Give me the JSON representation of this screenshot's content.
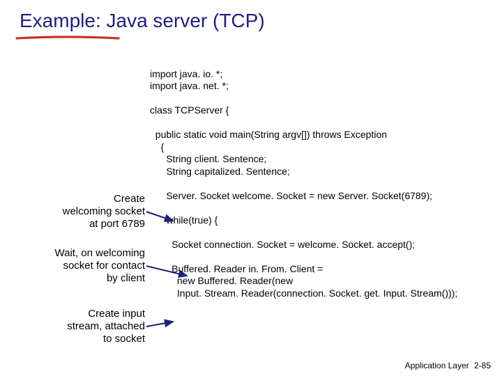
{
  "title": "Example: Java server (TCP)",
  "code": {
    "l1": "import java. io. *;",
    "l2": "import java. net. *;",
    "l3": "class TCPServer {",
    "l4": "  public static void main(String argv[]) throws Exception",
    "l5": "    {",
    "l6": "      String client. Sentence;",
    "l7": "      String capitalized. Sentence;",
    "l8": "      Server. Socket welcome. Socket = new Server. Socket(6789);",
    "l9": "      while(true) {",
    "l10": "        Socket connection. Socket = welcome. Socket. accept();",
    "l11": "        Buffered. Reader in. From. Client =",
    "l12": "          new Buffered. Reader(new",
    "l13": "          Input. Stream. Reader(connection. Socket. get. Input. Stream()));"
  },
  "labels": {
    "a": "Create\nwelcoming socket\nat port 6789",
    "b": "Wait, on welcoming\nsocket for contact\nby client",
    "c": "Create input\nstream, attached\nto socket"
  },
  "footer": {
    "section": "Application Layer",
    "page": "2-85"
  }
}
